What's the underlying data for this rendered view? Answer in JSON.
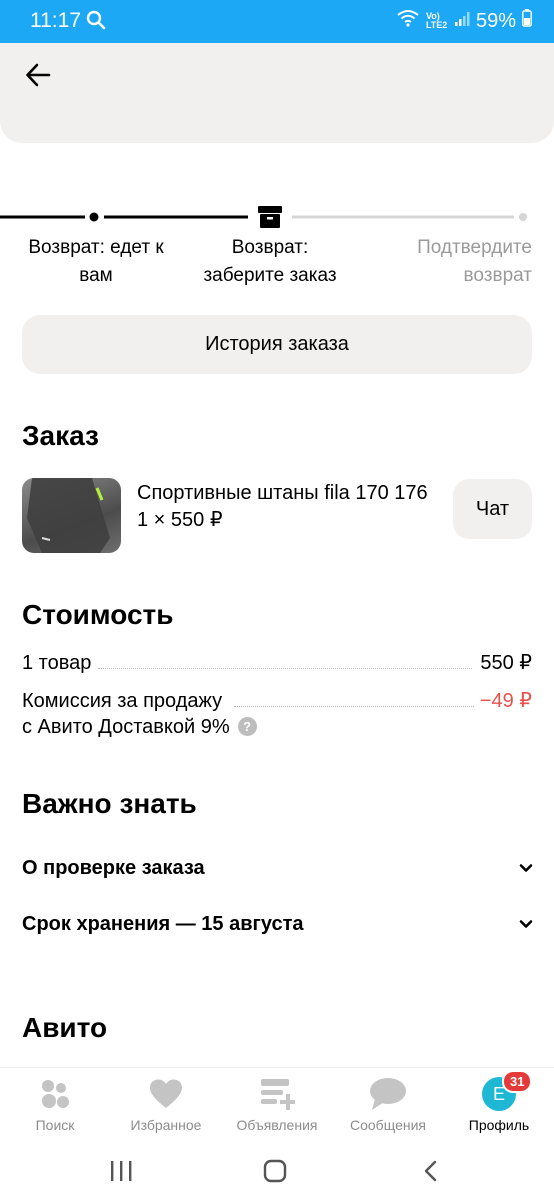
{
  "status_bar": {
    "time": "11:17",
    "network": "Vo) LTE2",
    "battery": "59%"
  },
  "steps": {
    "step1": "Возврат: едет к вам",
    "step2": "Возврат: заберите заказ",
    "step3": "Подтвердите возврат"
  },
  "history_button": "История заказа",
  "order": {
    "heading": "Заказ",
    "product_title": "Спортивные штаны fila 170 176",
    "product_qty": "1 × 550 ₽",
    "chat_button": "Чат"
  },
  "cost": {
    "heading": "Стоимость",
    "item_label": "1 товар",
    "item_value": "550 ₽",
    "commission_label_line1": "Комиссия за продажу",
    "commission_label_line2": "с Авито Доставкой 9%",
    "commission_value": "−49 ₽",
    "help": "?"
  },
  "important": {
    "heading": "Важно знать",
    "items": [
      "О проверке заказа",
      "Срок хранения — 15 августа"
    ]
  },
  "avito_heading": "Авито",
  "bottom_nav": {
    "items": [
      "Поиск",
      "Избранное",
      "Объявления",
      "Сообщения",
      "Профиль"
    ],
    "profile_initial": "E",
    "profile_badge": "31"
  },
  "colors": {
    "status_bar": "#1ca8f5",
    "accent_red": "#e8524a",
    "avatar": "#1fb8d4",
    "badge": "#e53a3a"
  }
}
